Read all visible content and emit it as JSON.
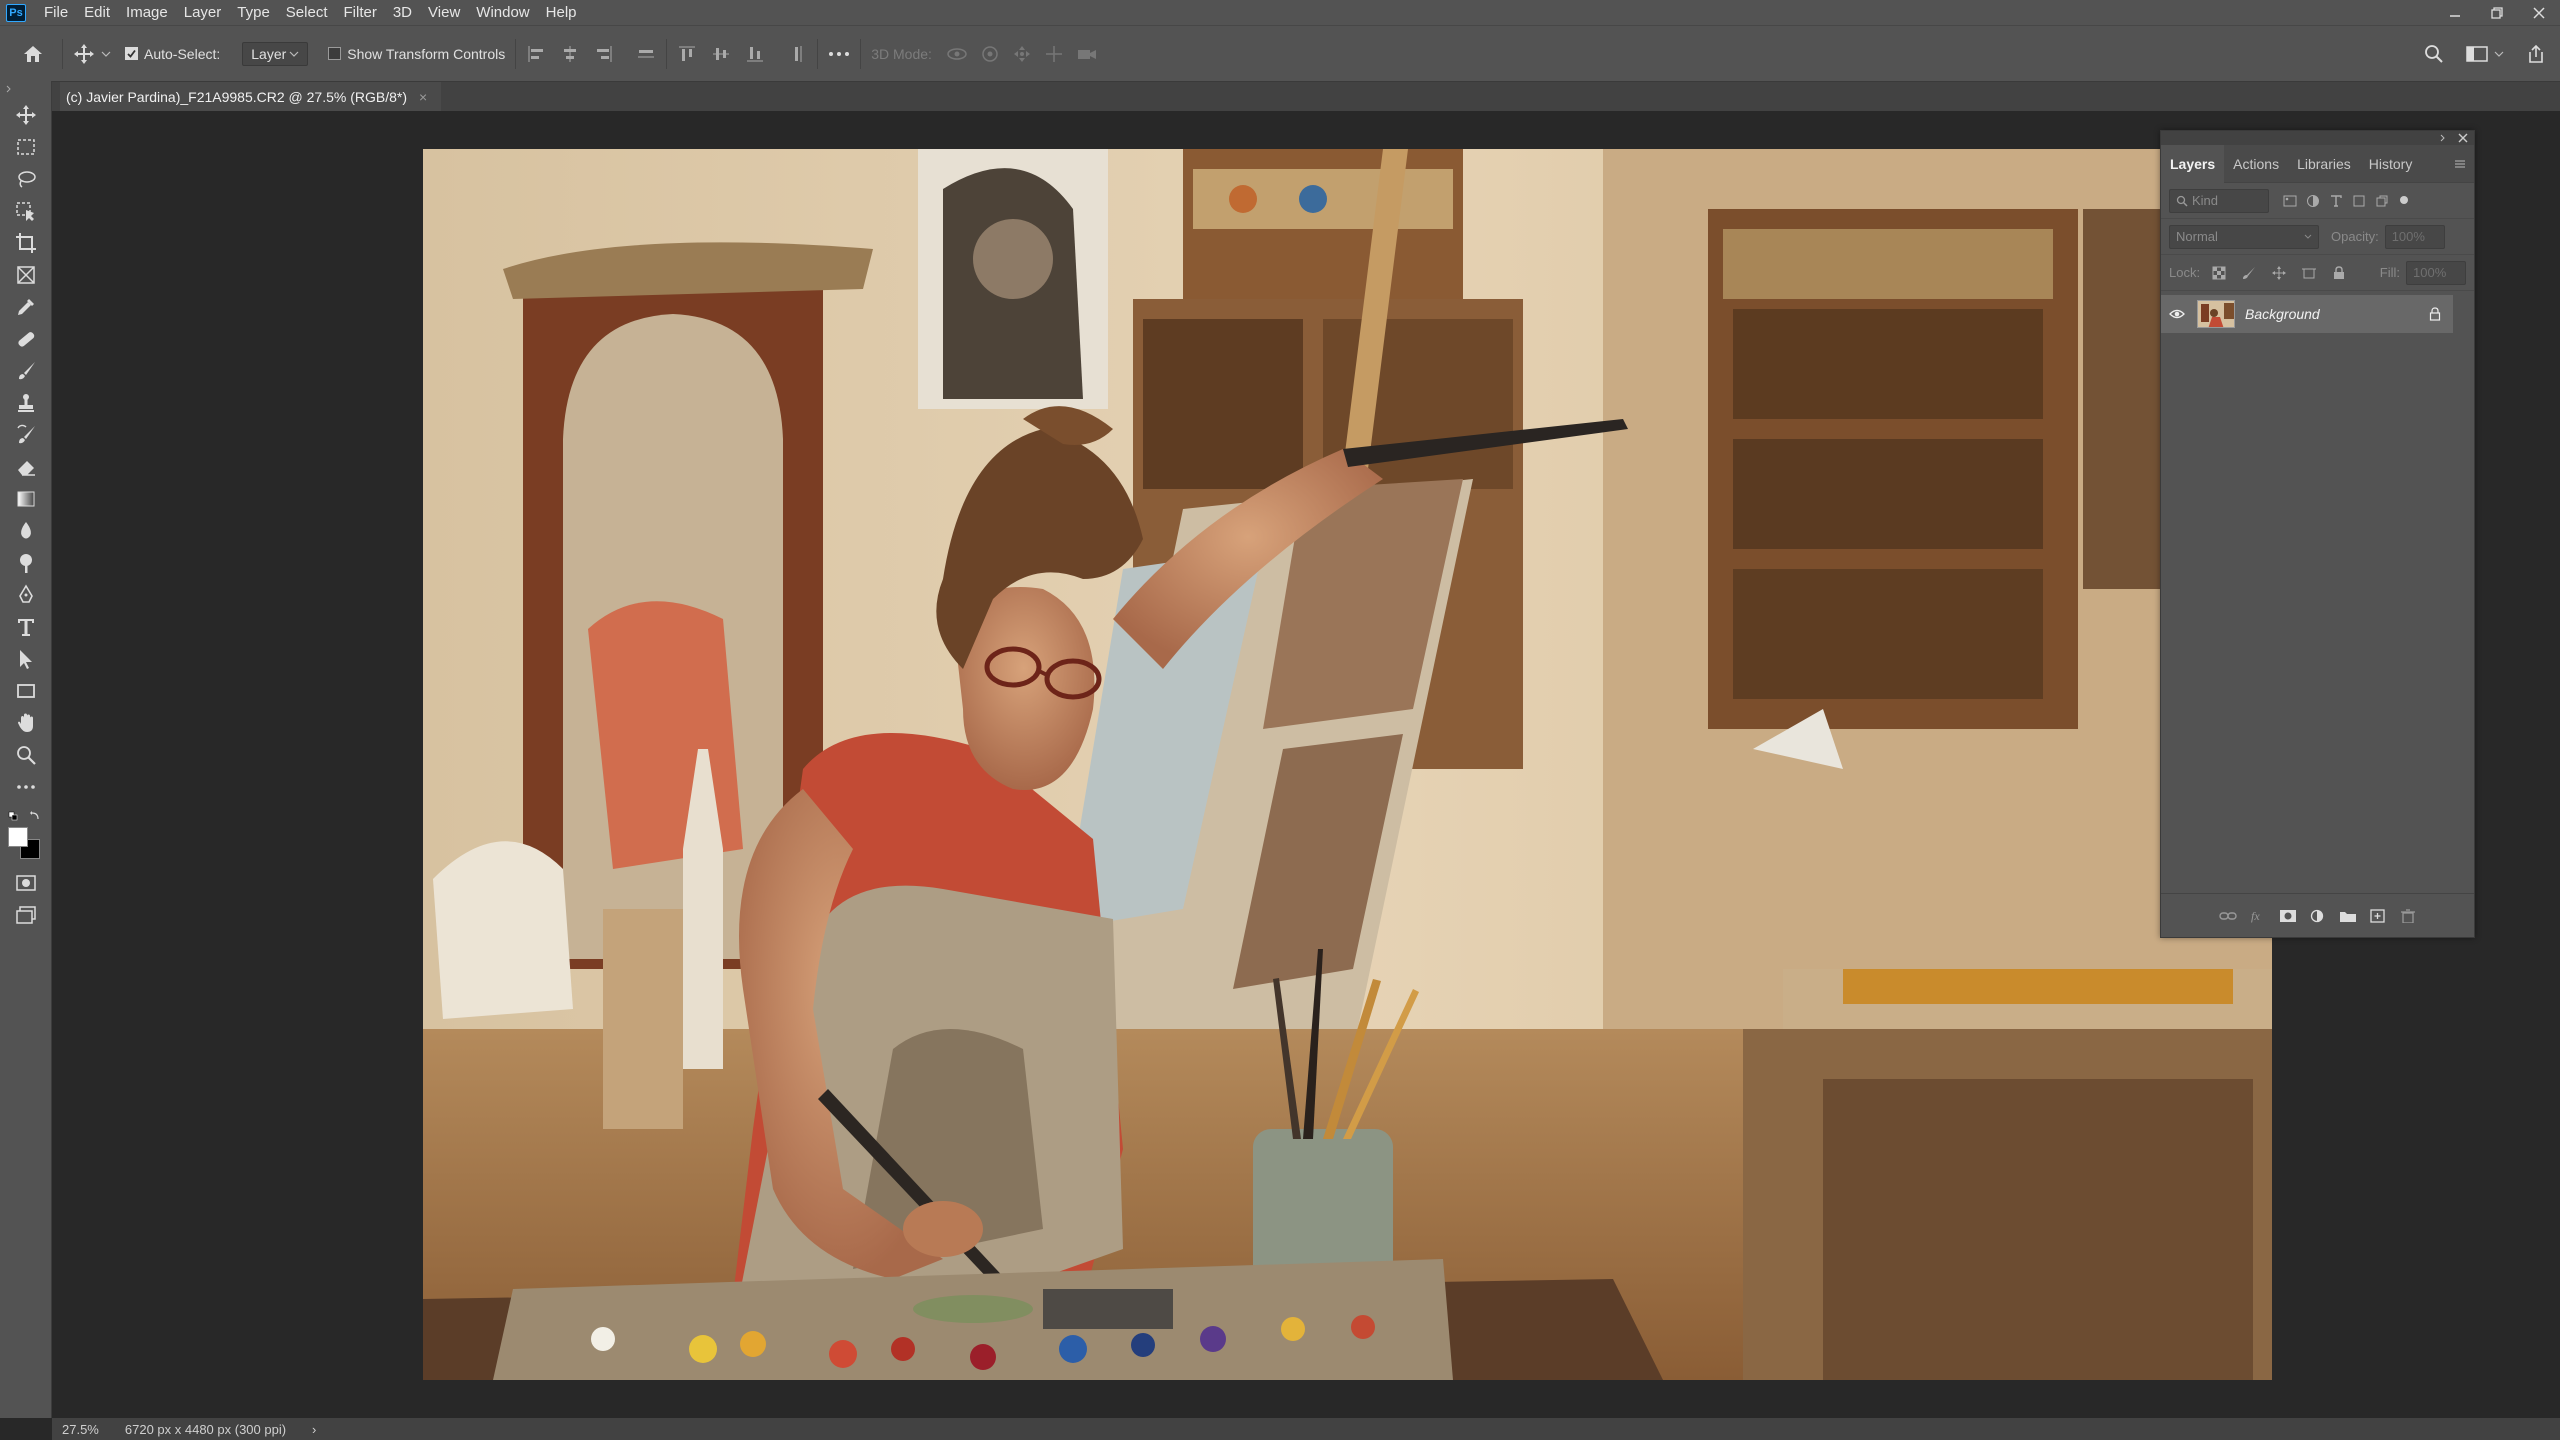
{
  "app": {
    "logo_text": "Ps"
  },
  "menu": [
    "File",
    "Edit",
    "Image",
    "Layer",
    "Type",
    "Select",
    "Filter",
    "3D",
    "View",
    "Window",
    "Help"
  ],
  "options": {
    "auto_select_label": "Auto-Select:",
    "auto_select_checked": true,
    "auto_select_target": "Layer",
    "show_transform_label": "Show Transform Controls",
    "show_transform_checked": false,
    "mode_3d_label": "3D Mode:"
  },
  "document": {
    "tab_title": "(c) Javier Pardina)_F21A9985.CR2 @ 27.5% (RGB/8*)",
    "close_glyph": "×"
  },
  "tools": [
    "move-icon",
    "marquee-icon",
    "lasso-icon",
    "object-select-icon",
    "crop-icon",
    "frame-icon",
    "eyedropper-icon",
    "healing-icon",
    "brush-icon",
    "stamp-icon",
    "history-brush-icon",
    "eraser-icon",
    "gradient-icon",
    "blur-icon",
    "dodge-icon",
    "pen-icon",
    "type-icon",
    "path-select-icon",
    "rectangle-icon",
    "hand-icon",
    "zoom-icon",
    "more-tools-icon"
  ],
  "layers_panel": {
    "tabs": [
      "Layers",
      "Actions",
      "Libraries",
      "History"
    ],
    "active_tab": "Layers",
    "filter_placeholder": "Kind",
    "blend_mode": "Normal",
    "opacity_label": "Opacity:",
    "opacity_value": "100%",
    "lock_label": "Lock:",
    "fill_label": "Fill:",
    "fill_value": "100%",
    "layers": [
      {
        "name": "Background",
        "visible": true,
        "locked": true
      }
    ]
  },
  "status": {
    "zoom": "27.5%",
    "doc_info": "6720 px x 4480 px (300 ppi)",
    "arrow": "›"
  },
  "colors": {
    "chrome": "#535353",
    "canvas_bg": "#282828",
    "tab_bar": "#424242",
    "accent": "#31a8ff"
  }
}
